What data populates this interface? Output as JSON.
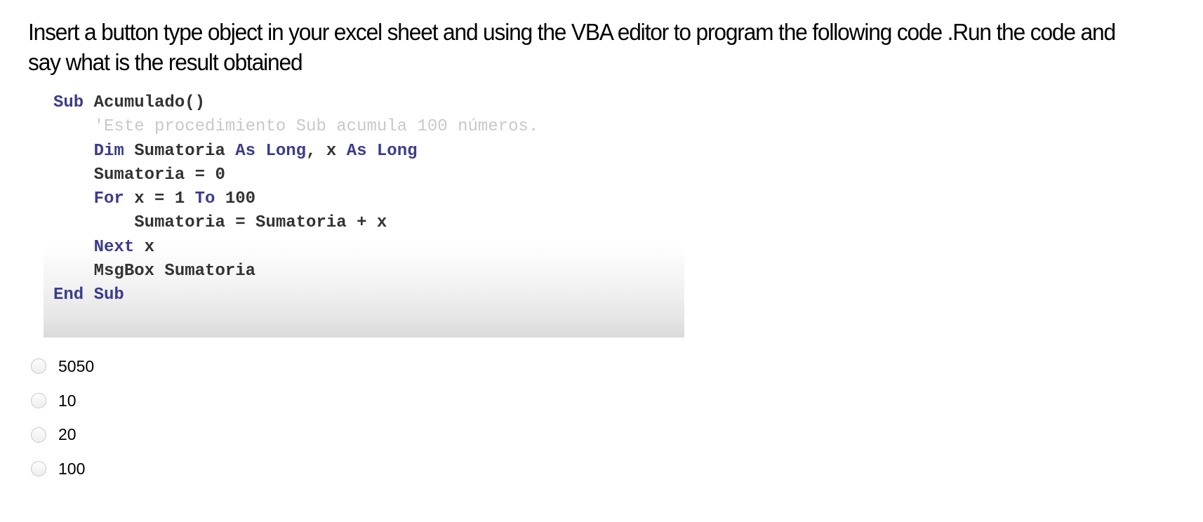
{
  "question": {
    "text": "Insert a button type object in your excel sheet and using the VBA editor to program the following code .Run the code and say what is the result obtained"
  },
  "code": {
    "lines": [
      {
        "indent": "",
        "tokens": [
          {
            "t": "Sub ",
            "k": "kw"
          },
          {
            "t": "Acumulado()",
            "k": "id"
          }
        ]
      },
      {
        "indent": "    ",
        "tokens": [
          {
            "t": "'Este procedimiento Sub acumula 100 números.",
            "k": "cm"
          }
        ]
      },
      {
        "indent": "    ",
        "tokens": [
          {
            "t": "Dim ",
            "k": "kw"
          },
          {
            "t": "Sumatoria ",
            "k": "id"
          },
          {
            "t": "As Long",
            "k": "kw"
          },
          {
            "t": ", x ",
            "k": "id"
          },
          {
            "t": "As Long",
            "k": "kw"
          }
        ]
      },
      {
        "indent": "    ",
        "tokens": [
          {
            "t": "Sumatoria = 0",
            "k": "id"
          }
        ]
      },
      {
        "indent": "    ",
        "tokens": [
          {
            "t": "For ",
            "k": "kw"
          },
          {
            "t": "x = 1 ",
            "k": "id"
          },
          {
            "t": "To ",
            "k": "kw"
          },
          {
            "t": "100",
            "k": "id"
          }
        ]
      },
      {
        "indent": "        ",
        "tokens": [
          {
            "t": "Sumatoria = Sumatoria + x",
            "k": "id"
          }
        ]
      },
      {
        "indent": "    ",
        "tokens": [
          {
            "t": "Next ",
            "k": "kw"
          },
          {
            "t": "x",
            "k": "id"
          }
        ]
      },
      {
        "indent": "    ",
        "tokens": [
          {
            "t": "MsgBox Sumatoria",
            "k": "id"
          }
        ]
      },
      {
        "indent": "",
        "tokens": [
          {
            "t": "End Sub",
            "k": "kw"
          }
        ]
      }
    ]
  },
  "options": [
    {
      "label": "5050",
      "selected": false
    },
    {
      "label": "10",
      "selected": false
    },
    {
      "label": "20",
      "selected": false
    },
    {
      "label": "100",
      "selected": false
    }
  ]
}
